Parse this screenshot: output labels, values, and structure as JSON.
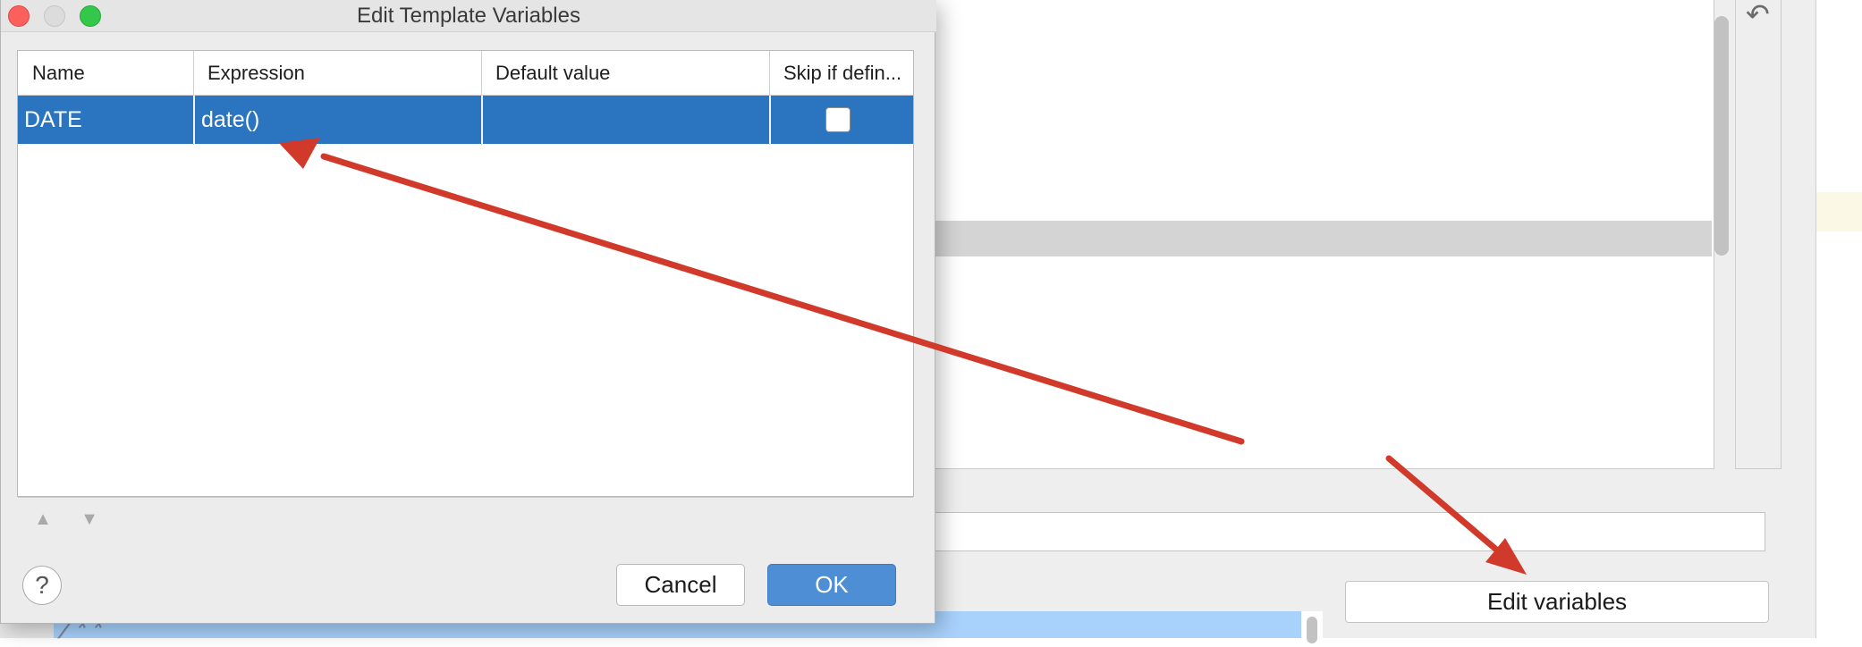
{
  "dialog": {
    "title": "Edit Template Variables",
    "window_controls": [
      "close",
      "minimize",
      "maximize"
    ],
    "table": {
      "columns": [
        "Name",
        "Expression",
        "Default value",
        "Skip if defin..."
      ],
      "rows": [
        {
          "name": "DATE",
          "expression": "date()",
          "default_value": "",
          "skip_if_defined": false,
          "selected": true
        }
      ],
      "toolbar": {
        "move_up_icon": "triangle-up-icon",
        "move_down_icon": "triangle-down-icon"
      }
    },
    "buttons": {
      "help": "?",
      "cancel": "Cancel",
      "ok": "OK"
    }
  },
  "background": {
    "edit_variables_button": "Edit variables",
    "code_snippet": "/**",
    "undo_icon": "undo-icon"
  },
  "annotations": {
    "arrow_color": "#d13a2a",
    "arrows": [
      {
        "from": "background-edit-area",
        "to": "expression-cell"
      },
      {
        "from": "background-edit-area",
        "to": "edit-variables-button"
      }
    ]
  },
  "colors": {
    "selection": "#2a74c0",
    "ok_button": "#4e8ed4",
    "dialog_bg": "#ececec"
  }
}
